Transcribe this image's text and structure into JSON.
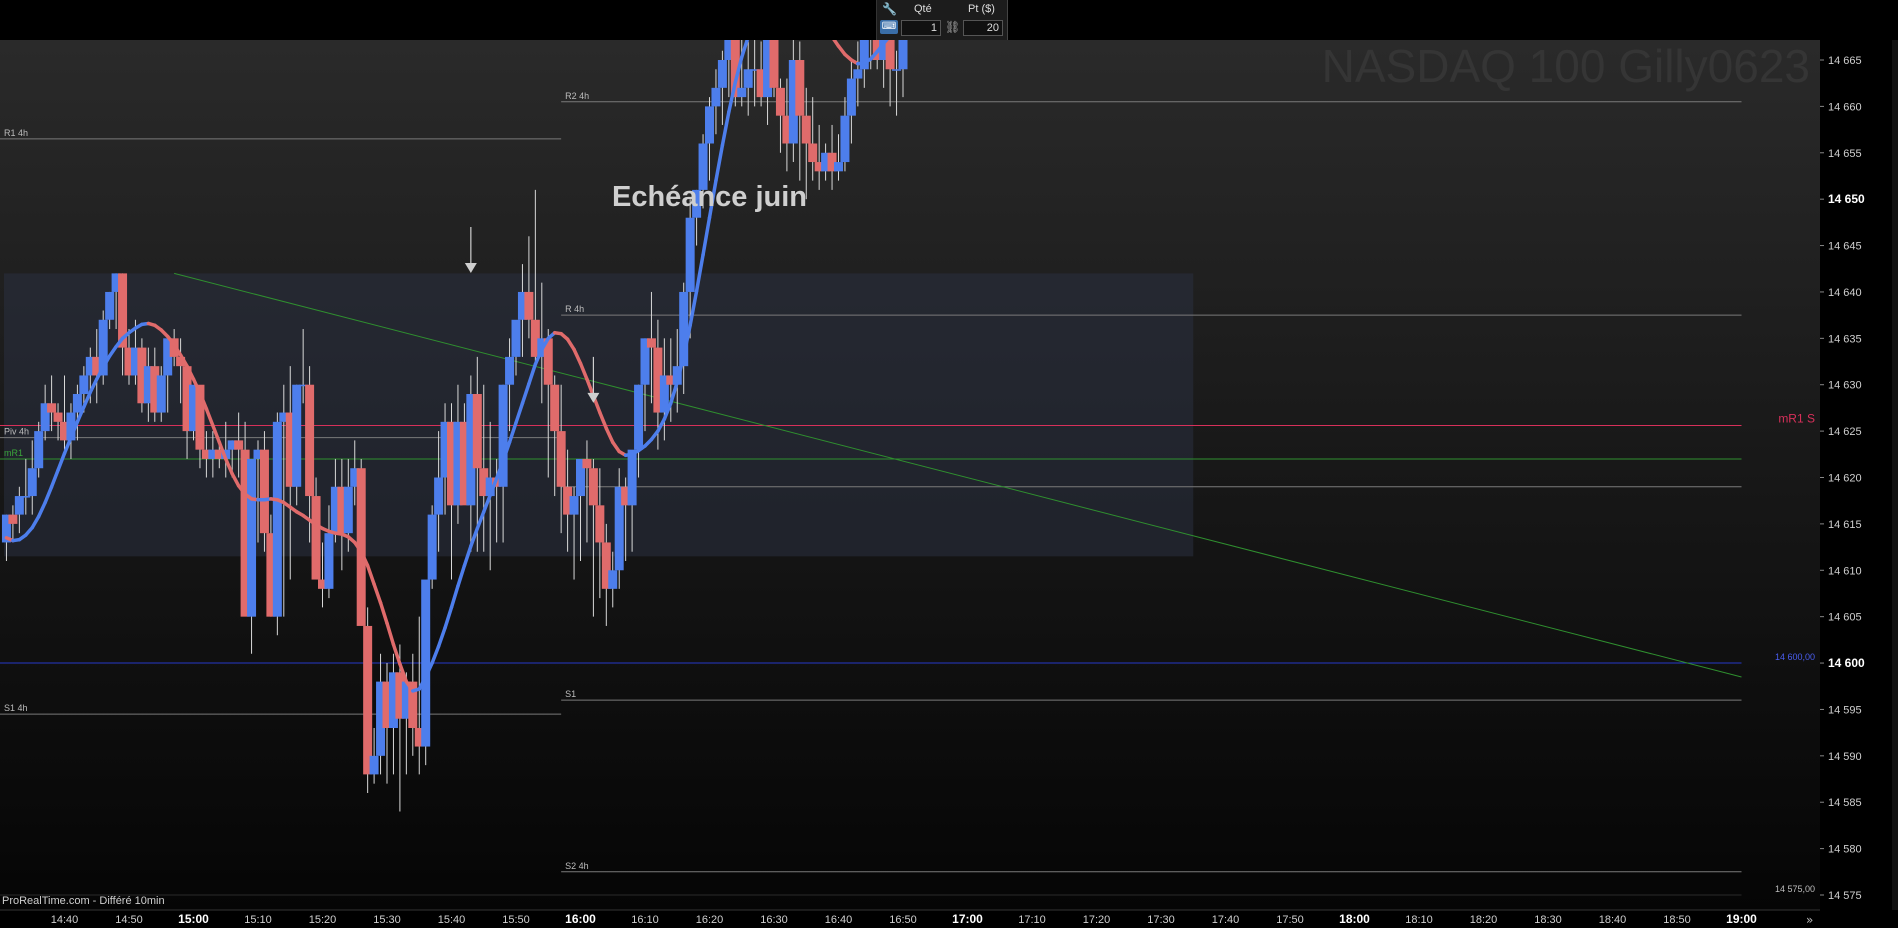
{
  "toolbar": {
    "qty_label": "Qté",
    "qty_value": "1",
    "pt_label": "Pt ($)",
    "pt_value": "20",
    "icons": [
      "wrench-icon",
      "keyboard-icon",
      "link-icon"
    ]
  },
  "colors": {
    "bull": "#4d7eec",
    "bear": "#e06b6b",
    "ma": "#4d7eec",
    "ma_down": "#e06b6b",
    "mR1": "#d7305a",
    "level_14600": "#2638c8",
    "green_line": "#2f8f2f",
    "background": "#141414",
    "zone": "#2a3040"
  },
  "chart_data": {
    "type": "candlestick",
    "title": "",
    "watermark": "NASDAQ 100 Gilly0623",
    "annotation": "Echéance juin",
    "source_label": "ProRealTime.com - Différé 10min",
    "xlabel": "",
    "ylabel": "",
    "ylim": [
      14572.5,
      14669
    ],
    "y_ticks": [
      14575,
      14580,
      14585,
      14590,
      14595,
      14600,
      14605,
      14610,
      14615,
      14620,
      14625,
      14630,
      14635,
      14640,
      14645,
      14650,
      14655,
      14660,
      14665
    ],
    "y_tick_labels": [
      "14 575",
      "14 580",
      "14 585",
      "14 590",
      "14 595",
      "14 600",
      "14 605",
      "14 610",
      "14 615",
      "14 620",
      "14 625",
      "14 630",
      "14 635",
      "14 640",
      "14 645",
      "14 650",
      "14 655",
      "14 660",
      "14 665"
    ],
    "y_bold_ticks": [
      "14 600",
      "14 650"
    ],
    "x_tick_labels": [
      "14:40",
      "14:50",
      "15:00",
      "15:10",
      "15:20",
      "15:30",
      "15:40",
      "15:50",
      "16:00",
      "16:10",
      "16:20",
      "16:30",
      "16:40",
      "16:50",
      "17:00",
      "17:10",
      "17:20",
      "17:30",
      "17:40",
      "17:50",
      "18:00",
      "18:10",
      "18:20",
      "18:30",
      "18:40",
      "18:50",
      "19:00"
    ],
    "x_bold_ticks": [
      "15:00",
      "16:00",
      "17:00",
      "18:00",
      "19:00"
    ],
    "x_start": "14:30",
    "bar_minutes": 1,
    "levels": [
      {
        "label": "R1 4h",
        "value": 14656.5,
        "from": "14:30",
        "to": "15:57"
      },
      {
        "label": "R2 4h",
        "value": 14660.5,
        "from": "15:57",
        "to": "19:00"
      },
      {
        "label": "R 4h",
        "value": 14637.5,
        "from": "15:57",
        "to": "19:00"
      },
      {
        "label": "Piv 4h",
        "value": 14624.3,
        "from": "14:30",
        "to": "15:57"
      },
      {
        "label": "mR1",
        "value": 14622,
        "from": "14:30",
        "to": "19:00"
      },
      {
        "label": "mR1 S",
        "value": 14625.6,
        "from": "14:30",
        "to": "19:00"
      },
      {
        "label": "",
        "value": 14619,
        "from": "15:57",
        "to": "19:00"
      },
      {
        "label": "14 600,00",
        "value": 14600,
        "from": "14:30",
        "to": "19:00"
      },
      {
        "label": "S1 4h",
        "value": 14594.5,
        "from": "14:30",
        "to": "15:57"
      },
      {
        "label": "S1",
        "value": 14596,
        "from": "15:57",
        "to": "19:00"
      },
      {
        "label": "S2 4h",
        "value": 14577.5,
        "from": "15:57",
        "to": "19:00"
      },
      {
        "label": "14 575,00",
        "value": 14575,
        "from": "14:30",
        "to": "19:00"
      }
    ],
    "zone": {
      "from": "14:30",
      "to": "17:35",
      "high": 14642,
      "low": 14611.5
    },
    "arrows": [
      {
        "time": "15:43",
        "value": 14647
      },
      {
        "time": "16:02",
        "value": 14633
      }
    ],
    "trendline": {
      "start": {
        "time": "14:57",
        "value": 14642
      },
      "end": {
        "time": "19:00",
        "value": 14598.5
      }
    },
    "ohlc": [
      [
        14613,
        14616,
        14611,
        14616
      ],
      [
        14616,
        14617,
        14613,
        14615
      ],
      [
        14616,
        14619,
        14614,
        14618
      ],
      [
        14618,
        14622,
        14616,
        14618
      ],
      [
        14618,
        14624,
        14616,
        14621
      ],
      [
        14621,
        14626,
        14620,
        14625
      ],
      [
        14625,
        14630,
        14624,
        14628
      ],
      [
        14628,
        14631,
        14625,
        14627
      ],
      [
        14627,
        14628,
        14624,
        14626
      ],
      [
        14626,
        14631,
        14623,
        14624
      ],
      [
        14624,
        14628,
        14622,
        14627
      ],
      [
        14627,
        14630,
        14624,
        14629
      ],
      [
        14629,
        14632,
        14627,
        14631
      ],
      [
        14631,
        14634,
        14628,
        14633
      ],
      [
        14633,
        14636,
        14628,
        14631
      ],
      [
        14631,
        14638,
        14630,
        14637
      ],
      [
        14637,
        14640,
        14636,
        14640
      ],
      [
        14640,
        14642,
        14636,
        14642
      ],
      [
        14642,
        14642,
        14631,
        14634
      ],
      [
        14634,
        14636,
        14630,
        14631
      ],
      [
        14631,
        14637,
        14630,
        14634
      ],
      [
        14634,
        14635,
        14627,
        14628
      ],
      [
        14628,
        14634,
        14626,
        14632
      ],
      [
        14632,
        14634,
        14626,
        14627
      ],
      [
        14627,
        14632,
        14626,
        14631
      ],
      [
        14631,
        14634,
        14627,
        14635
      ],
      [
        14635,
        14636,
        14632,
        14633
      ],
      [
        14633,
        14635,
        14628,
        14632
      ],
      [
        14632,
        14631,
        14622,
        14625
      ],
      [
        14625,
        14629,
        14624,
        14630
      ],
      [
        14630,
        14629,
        14621,
        14623
      ],
      [
        14623,
        14625,
        14620,
        14622
      ],
      [
        14622,
        14625,
        14620,
        14623
      ],
      [
        14623,
        14624,
        14621,
        14622
      ],
      [
        14622,
        14626,
        14620,
        14623
      ],
      [
        14623,
        14624,
        14620,
        14624
      ],
      [
        14624,
        14627,
        14620,
        14623
      ],
      [
        14623,
        14626,
        14615,
        14605
      ],
      [
        14605,
        14615,
        14601,
        14622
      ],
      [
        14622,
        14624,
        14613,
        14623
      ],
      [
        14623,
        14625,
        14612,
        14614
      ],
      [
        14614,
        14616,
        14605,
        14605
      ],
      [
        14605,
        14627,
        14603,
        14626
      ],
      [
        14626,
        14630,
        14605,
        14627
      ],
      [
        14627,
        14632,
        14609,
        14619
      ],
      [
        14619,
        14630,
        14617,
        14630
      ],
      [
        14630,
        14636,
        14628,
        14630
      ],
      [
        14630,
        14632,
        14613,
        14618
      ],
      [
        14618,
        14620,
        14610,
        14609
      ],
      [
        14609,
        14613,
        14606,
        14608
      ],
      [
        14608,
        14617,
        14607,
        14614
      ],
      [
        14614,
        14622,
        14613,
        14619
      ],
      [
        14619,
        14622,
        14610,
        14614
      ],
      [
        14614,
        14622,
        14612,
        14619
      ],
      [
        14619,
        14624,
        14617,
        14621
      ],
      [
        14621,
        14622,
        14608,
        14604
      ],
      [
        14604,
        14606,
        14586,
        14588
      ],
      [
        14588,
        14593,
        14587,
        14590
      ],
      [
        14590,
        14601,
        14588,
        14598
      ],
      [
        14598,
        14600,
        14587,
        14593
      ],
      [
        14593,
        14601,
        14588,
        14599
      ],
      [
        14599,
        14602,
        14584,
        14594
      ],
      [
        14594,
        14599,
        14588,
        14598
      ],
      [
        14598,
        14601,
        14590,
        14593
      ],
      [
        14593,
        14605,
        14588,
        14591
      ],
      [
        14591,
        14607,
        14589,
        14609
      ],
      [
        14609,
        14617,
        14608,
        14616
      ],
      [
        14616,
        14625,
        14612,
        14620
      ],
      [
        14620,
        14628,
        14616,
        14626
      ],
      [
        14626,
        14628,
        14609,
        14617
      ],
      [
        14617,
        14630,
        14615,
        14626
      ],
      [
        14626,
        14628,
        14618,
        14617
      ],
      [
        14617,
        14631,
        14612,
        14629
      ],
      [
        14629,
        14633,
        14612,
        14621
      ],
      [
        14621,
        14630,
        14612,
        14618
      ],
      [
        14618,
        14626,
        14610,
        14620
      ],
      [
        14620,
        14622,
        14613,
        14619
      ],
      [
        14619,
        14630,
        14613,
        14630
      ],
      [
        14630,
        14635,
        14625,
        14633
      ],
      [
        14633,
        14636,
        14631,
        14637
      ],
      [
        14637,
        14643,
        14633,
        14640
      ],
      [
        14640,
        14646,
        14635,
        14637
      ],
      [
        14637,
        14651,
        14632,
        14633
      ],
      [
        14633,
        14641,
        14628,
        14635
      ],
      [
        14635,
        14636,
        14620,
        14630
      ],
      [
        14630,
        14631,
        14618,
        14625
      ],
      [
        14625,
        14630,
        14614,
        14619
      ],
      [
        14619,
        14623,
        14612,
        14616
      ],
      [
        14616,
        14619,
        14609,
        14618
      ],
      [
        14618,
        14621,
        14611,
        14622
      ],
      [
        14622,
        14624,
        14613,
        14621
      ],
      [
        14621,
        14622,
        14605,
        14617
      ],
      [
        14617,
        14621,
        14607,
        14613
      ],
      [
        14613,
        14615,
        14604,
        14608
      ],
      [
        14608,
        14612,
        14606,
        14610
      ],
      [
        14610,
        14621,
        14608,
        14619
      ],
      [
        14619,
        14620,
        14611,
        14617
      ],
      [
        14617,
        14622,
        14612,
        14623
      ],
      [
        14623,
        14630,
        14620,
        14630
      ],
      [
        14630,
        14635,
        14625,
        14635
      ],
      [
        14635,
        14640,
        14628,
        14634
      ],
      [
        14634,
        14637,
        14623,
        14627
      ],
      [
        14627,
        14635,
        14624,
        14631
      ],
      [
        14631,
        14635,
        14626,
        14630
      ],
      [
        14630,
        14636,
        14627,
        14632
      ],
      [
        14632,
        14641,
        14629,
        14640
      ],
      [
        14640,
        14650,
        14635,
        14648
      ],
      [
        14648,
        14651,
        14645,
        14651
      ],
      [
        14651,
        14657,
        14649,
        14656
      ],
      [
        14656,
        14661,
        14652,
        14660
      ],
      [
        14660,
        14664,
        14657,
        14662
      ],
      [
        14662,
        14666,
        14658,
        14665
      ],
      [
        14665,
        14668,
        14661,
        14668
      ],
      [
        14668,
        14669,
        14660,
        14661
      ],
      [
        14661,
        14668,
        14660,
        14662
      ],
      [
        14662,
        14667,
        14659,
        14664
      ],
      [
        14664,
        14669,
        14660,
        14664
      ],
      [
        14664,
        14667,
        14660,
        14661
      ],
      [
        14661,
        14668,
        14658,
        14668
      ],
      [
        14668,
        14669,
        14661,
        14662
      ],
      [
        14662,
        14663,
        14655,
        14659
      ],
      [
        14659,
        14663,
        14653,
        14656
      ],
      [
        14656,
        14668,
        14654,
        14665
      ],
      [
        14665,
        14667,
        14652,
        14659
      ],
      [
        14659,
        14662,
        14650,
        14656
      ],
      [
        14656,
        14661,
        14652,
        14654
      ],
      [
        14654,
        14658,
        14651,
        14653
      ],
      [
        14653,
        14656,
        14652,
        14655
      ],
      [
        14655,
        14658,
        14651,
        14653
      ],
      [
        14653,
        14657,
        14652,
        14654
      ],
      [
        14654,
        14661,
        14653,
        14659
      ],
      [
        14659,
        14665,
        14656,
        14663
      ],
      [
        14663,
        14667,
        14660,
        14664
      ],
      [
        14664,
        14669,
        14662,
        14668
      ],
      [
        14668,
        14669,
        14664,
        14668
      ],
      [
        14668,
        14669,
        14664,
        14665
      ],
      [
        14665,
        14669,
        14662,
        14668
      ],
      [
        14668,
        14669,
        14660,
        14664
      ],
      [
        14664,
        14666,
        14659,
        14664
      ],
      [
        14664,
        14669,
        14661,
        14668
      ]
    ],
    "ma": [
      14613.5,
      14613.2,
      14613.3,
      14613.8,
      14614.6,
      14615.8,
      14617.3,
      14619,
      14620.8,
      14622.6,
      14624.3,
      14626,
      14627.6,
      14629.2,
      14630.6,
      14631.9,
      14633.1,
      14634.1,
      14635,
      14635.6,
      14636.1,
      14636.5,
      14636.6,
      14636.4,
      14635.9,
      14635.2,
      14634.3,
      14633.2,
      14632,
      14630.6,
      14629.1,
      14627.4,
      14625.6,
      14623.8,
      14622,
      14620.4,
      14619.1,
      14618.2,
      14617.7,
      14617.6,
      14617.6,
      14617.7,
      14617.6,
      14617.3,
      14616.8,
      14616.3,
      14615.9,
      14615.4,
      14614.9,
      14614.5,
      14614.2,
      14614,
      14613.9,
      14613.6,
      14613,
      14612,
      14610.5,
      14608.5,
      14606.5,
      14604.3,
      14602,
      14599.9,
      14598,
      14597,
      14597.2,
      14598.5,
      14600,
      14601.8,
      14603.8,
      14606,
      14608.3,
      14610.5,
      14612.6,
      14614.5,
      14616.3,
      14618.1,
      14619.9,
      14621.8,
      14623.8,
      14625.9,
      14628,
      14630.1,
      14632.2,
      14633.8,
      14635,
      14635.6,
      14635.5,
      14634.9,
      14633.8,
      14632.3,
      14630.6,
      14628.8,
      14627,
      14625.3,
      14623.8,
      14622.8,
      14622.4,
      14622.5,
      14622.9,
      14623.4,
      14624.1,
      14625,
      14626.3,
      14628,
      14630.3,
      14633.1,
      14636.4,
      14640.1,
      14644,
      14648,
      14652,
      14655.8,
      14659.4,
      14662.6,
      14665.3,
      14667.5,
      14669.3,
      14670.8,
      14672,
      14672.8,
      14673.2,
      14673.3,
      14673,
      14672.4,
      14671.6,
      14670.7,
      14669.7,
      14668.6,
      14667.5,
      14666.5,
      14665.6,
      14665,
      14664.6,
      14664.7,
      14665.1,
      14665.9,
      14666.8,
      14667.6,
      14668.3,
      14669
    ]
  }
}
